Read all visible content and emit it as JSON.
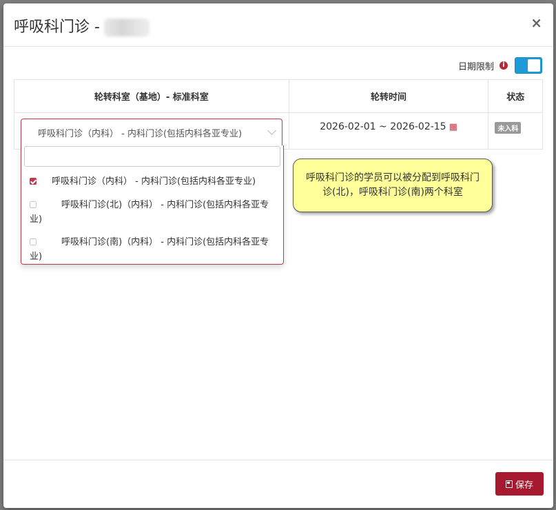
{
  "modal": {
    "title": "呼吸科门诊 -",
    "close_label": "×"
  },
  "date_limit": {
    "label": "日期限制",
    "info_icon": "info-icon",
    "toggle_on": true,
    "accent": "#1e9ad6"
  },
  "table": {
    "headers": [
      "轮转科室（基地）- 标准科室",
      "轮转时间",
      "状态"
    ],
    "row": {
      "rotation_time": "2026-02-01 ~ 2026-02-15",
      "status": "未入科"
    }
  },
  "select": {
    "value": "呼吸科门诊（内科） - 内科门诊(包括内科各亚专业)",
    "search_value": "",
    "options": [
      {
        "label": "呼吸科门诊（内科） - 内科门诊(包括内科各亚专业)",
        "checked": true
      },
      {
        "label": "呼吸科门诊(北)（内科） - 内科门诊(包括内科各亚专业)",
        "checked": false
      },
      {
        "label": "呼吸科门诊(南)（内科） - 内科门诊(包括内科各亚专业)",
        "checked": false
      }
    ]
  },
  "tooltip": {
    "text": "呼吸科门诊的学员可以被分配到呼吸科门诊(北)，呼吸科门诊(南)两个科室"
  },
  "footer": {
    "save_label": "保存",
    "save_icon": "floppy-disk-icon",
    "accent": "#a6192e"
  }
}
